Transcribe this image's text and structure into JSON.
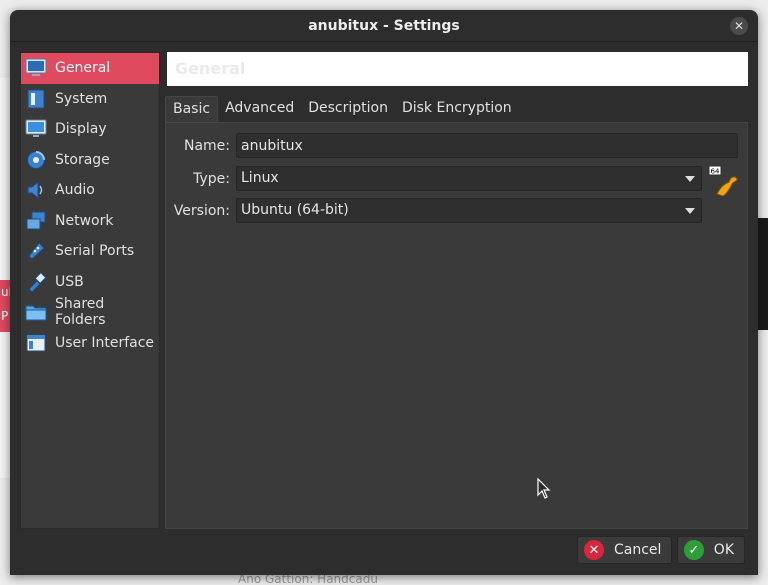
{
  "window": {
    "title": "anubitux - Settings",
    "close_glyph": "✕"
  },
  "background": {
    "left_red_text": "ub\nP",
    "bottom_text": "Ano Gattion: Handcadu"
  },
  "sidebar": {
    "items": [
      {
        "label": "General",
        "icon": "general-icon",
        "active": true
      },
      {
        "label": "System",
        "icon": "system-icon"
      },
      {
        "label": "Display",
        "icon": "display-icon"
      },
      {
        "label": "Storage",
        "icon": "storage-icon"
      },
      {
        "label": "Audio",
        "icon": "audio-icon"
      },
      {
        "label": "Network",
        "icon": "network-icon"
      },
      {
        "label": "Serial Ports",
        "icon": "serial-ports-icon"
      },
      {
        "label": "USB",
        "icon": "usb-icon"
      },
      {
        "label": "Shared Folders",
        "icon": "shared-folders-icon"
      },
      {
        "label": "User Interface",
        "icon": "user-interface-icon"
      }
    ]
  },
  "header": {
    "title": "General"
  },
  "tabs": [
    {
      "label": "Basic",
      "active": true
    },
    {
      "label": "Advanced"
    },
    {
      "label": "Description"
    },
    {
      "label": "Disk Encryption"
    }
  ],
  "form": {
    "name_label": "Name:",
    "name_value": "anubitux",
    "type_label": "Type:",
    "type_value": "Linux",
    "version_label": "Version:",
    "version_value": "Ubuntu (64-bit)",
    "os_badge": "64"
  },
  "footer": {
    "cancel_label": "Cancel",
    "ok_label": "OK"
  },
  "colors": {
    "accent": "#e04a5f",
    "ok": "#2e9d3a",
    "cancel": "#d9263c"
  }
}
